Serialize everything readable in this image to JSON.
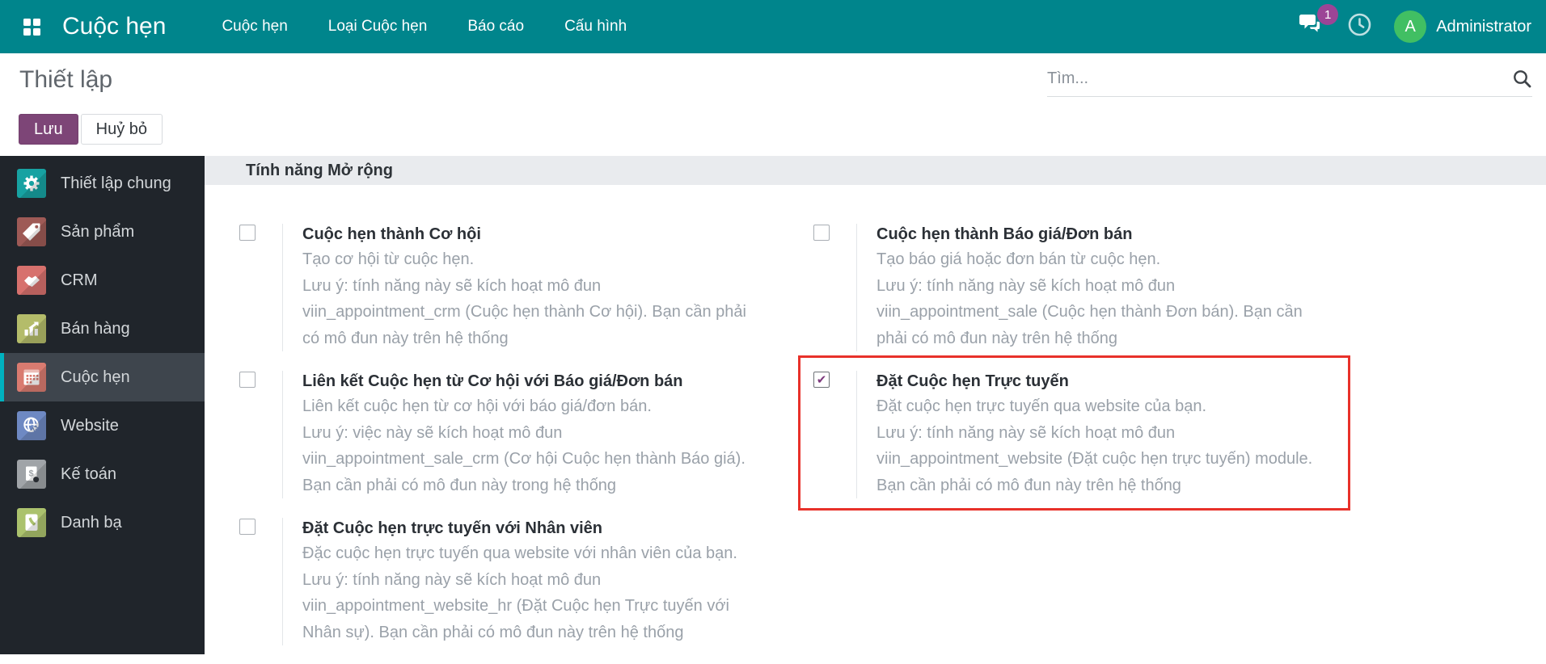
{
  "topbar": {
    "brand": "Cuộc hẹn",
    "menu": [
      "Cuộc hẹn",
      "Loại Cuộc hẹn",
      "Báo cáo",
      "Cấu hình"
    ],
    "messages_badge": "1",
    "user_initial": "A",
    "user_name": "Administrator"
  },
  "header": {
    "title": "Thiết lập",
    "save_label": "Lưu",
    "discard_label": "Huỷ bỏ",
    "search_placeholder": "Tìm..."
  },
  "sidebar": {
    "items": [
      {
        "label": "Thiết lập chung",
        "icon": "gear-icon",
        "color": "#17a2a2",
        "active": false
      },
      {
        "label": "Sản phẩm",
        "icon": "tag-icon",
        "color": "#9e5a56",
        "active": false
      },
      {
        "label": "CRM",
        "icon": "handshake-icon",
        "color": "#d7716d",
        "active": false
      },
      {
        "label": "Bán hàng",
        "icon": "bar-chart-icon",
        "color": "#b4bc6a",
        "active": false
      },
      {
        "label": "Cuộc hẹn",
        "icon": "calendar-icon",
        "color": "#d97b70",
        "active": true
      },
      {
        "label": "Website",
        "icon": "globe-icon",
        "color": "#6e89c3",
        "active": false
      },
      {
        "label": "Kế toán",
        "icon": "invoice-icon",
        "color": "#a0a4a8",
        "active": false
      },
      {
        "label": "Danh bạ",
        "icon": "contact-icon",
        "color": "#abc26d",
        "active": false
      }
    ]
  },
  "main": {
    "section_header": "Tính năng Mở rộng",
    "settings": [
      {
        "title": "Cuộc hẹn thành Cơ hội",
        "checked": false,
        "highlighted": false,
        "desc_lines": [
          "Tạo cơ hội từ cuộc hẹn.",
          "Lưu ý: tính năng này sẽ kích hoạt mô đun",
          "viin_appointment_crm (Cuộc hẹn thành Cơ hội). Bạn cần phải",
          "có mô đun này trên hệ thống"
        ]
      },
      {
        "title": "Cuộc hẹn thành Báo giá/Đơn bán",
        "checked": false,
        "highlighted": false,
        "desc_lines": [
          "Tạo báo giá hoặc đơn bán từ cuộc hẹn.",
          "Lưu ý: tính năng này sẽ kích hoạt mô đun",
          "viin_appointment_sale (Cuộc hẹn thành Đơn bán). Bạn cần",
          "phải có mô đun này trên hệ thống"
        ]
      },
      {
        "title": "Liên kết Cuộc hẹn từ Cơ hội với Báo giá/Đơn bán",
        "checked": false,
        "highlighted": false,
        "desc_lines": [
          "Liên kết cuộc hẹn từ cơ hội với báo giá/đơn bán.",
          "Lưu ý: việc này sẽ kích hoạt mô đun",
          "viin_appointment_sale_crm (Cơ hội Cuộc hẹn thành Báo giá).",
          "Bạn cần phải có mô đun này trong hệ thống"
        ]
      },
      {
        "title": "Đặt Cuộc hẹn Trực tuyến",
        "checked": true,
        "highlighted": true,
        "desc_lines": [
          "Đặt cuộc hẹn trực tuyến qua website của bạn.",
          "Lưu ý: tính năng này sẽ kích hoạt mô đun",
          "viin_appointment_website (Đặt cuộc hẹn trực tuyến) module.",
          "Bạn cần phải có mô đun này trên hệ thống"
        ]
      },
      {
        "title": "Đặt Cuộc hẹn trực tuyến với Nhân viên",
        "checked": false,
        "highlighted": false,
        "desc_lines": [
          "Đặc cuộc hẹn trực tuyến qua website với nhân viên của bạn.",
          "Lưu ý: tính năng này sẽ kích hoạt mô đun",
          "viin_appointment_website_hr (Đặt Cuộc hẹn Trực tuyến với",
          "Nhân sự). Bạn cần phải có mô đun này trên hệ thống"
        ]
      }
    ]
  },
  "colors": {
    "topbar_teal": "#00858c",
    "sidebar_dark": "#20252b",
    "sidebar_active": "#3e454d",
    "sidebar_active_bar": "#00b2bf",
    "save_purple": "#7d4577",
    "highlight_red": "#e8312a",
    "badge_purple": "#9c4596",
    "avatar_green": "#41bf63",
    "check_purple": "#7d3a7d"
  }
}
